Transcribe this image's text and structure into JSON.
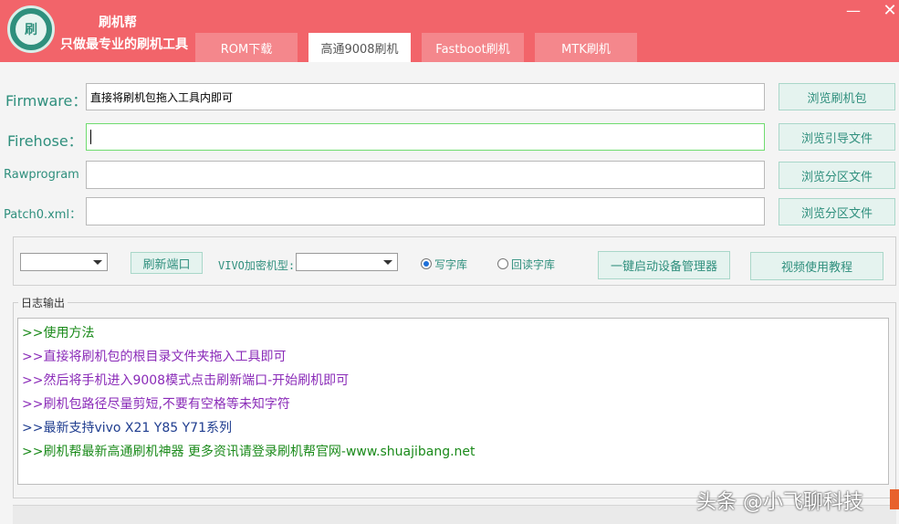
{
  "app": {
    "name": "刷机帮",
    "slogan": "只做最专业的刷机工具",
    "logo_glyph": "刷"
  },
  "window": {
    "minimize_glyph": "—",
    "close_glyph": "✕"
  },
  "tabs": [
    {
      "label": "ROM下载",
      "active": false
    },
    {
      "label": "高通9008刷机",
      "active": true
    },
    {
      "label": "Fastboot刷机",
      "active": false
    },
    {
      "label": "MTK刷机",
      "active": false
    }
  ],
  "fields": {
    "firmware": {
      "label": "Firmware：",
      "value": "直接将刷机包拖入工具内即可",
      "button": "浏览刷机包"
    },
    "firehose": {
      "label": "Firehose：",
      "value": "",
      "button": "浏览引导文件"
    },
    "rawprogram": {
      "label": "Rawprogram",
      "value": "",
      "button": "浏览分区文件"
    },
    "patch0": {
      "label": "Patch0.xml：",
      "value": "",
      "button": "浏览分区文件"
    }
  },
  "options": {
    "port_select": "",
    "refresh_port": "刷新端口",
    "vivo_label": "VIVO加密机型:",
    "vivo_select": "",
    "radio_write": "写字库",
    "radio_read": "回读字库",
    "radio_selected": "write",
    "device_manager": "一键启动设备管理器",
    "video_tutorial": "视频使用教程"
  },
  "log": {
    "title": "日志输出",
    "lines": [
      {
        "text": ">>使用方法",
        "color": "#1a8a1a"
      },
      {
        "text": ">>直接将刷机包的根目录文件夹拖入工具即可",
        "color": "#8a2bb8"
      },
      {
        "text": ">>然后将手机进入9008模式点击刷新端口-开始刷机即可",
        "color": "#8a2bb8"
      },
      {
        "text": ">>刷机包路径尽量剪短,不要有空格等未知字符",
        "color": "#8a2bb8"
      },
      {
        "text": ">>最新支持vivo X21 Y85 Y71系列",
        "color": "#1f3d8f"
      },
      {
        "text": ">>刷机帮最新高通刷机神器 更多资讯请登录刷机帮官网-www.shuajibang.net",
        "color": "#1a8a1a"
      }
    ]
  },
  "watermark": "头条 @小飞聊科技",
  "colors": {
    "titlebar": "#f2646a",
    "tab_inactive": "#f4878c",
    "accent_green": "#2f8f7d",
    "log_green": "#1a8a1a",
    "log_purple": "#8a2bb8",
    "log_blue": "#1f3d8f"
  }
}
